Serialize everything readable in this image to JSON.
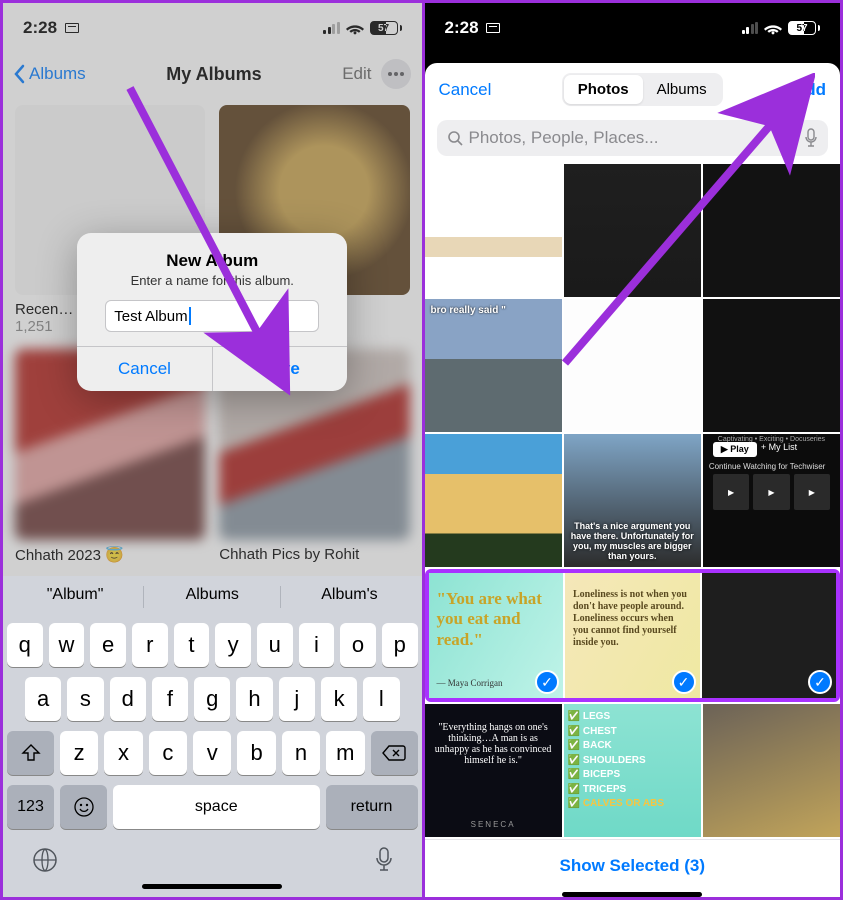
{
  "status": {
    "time": "2:28",
    "battery": "57"
  },
  "left": {
    "back": "Albums",
    "title": "My Albums",
    "edit": "Edit",
    "albums": [
      {
        "name": "Recen…",
        "count": "1,251"
      },
      {
        "name": "",
        "count": ""
      },
      {
        "name": "Chhath 2023 😇",
        "count": ""
      },
      {
        "name": "Chhath Pics by Rohit",
        "count": ""
      }
    ],
    "alert": {
      "title": "New Album",
      "subtitle": "Enter a name for this album.",
      "value": "Test Album",
      "cancel": "Cancel",
      "save": "Save"
    },
    "keyboard": {
      "predict": [
        "\"Album\"",
        "Albums",
        "Album's"
      ],
      "row1": [
        "q",
        "w",
        "e",
        "r",
        "t",
        "y",
        "u",
        "i",
        "o",
        "p"
      ],
      "row2": [
        "a",
        "s",
        "d",
        "f",
        "g",
        "h",
        "j",
        "k",
        "l"
      ],
      "row3": [
        "z",
        "x",
        "c",
        "v",
        "b",
        "n",
        "m"
      ],
      "num": "123",
      "space": "space",
      "ret": "return"
    }
  },
  "right": {
    "cancel": "Cancel",
    "seg_photos": "Photos",
    "seg_albums": "Albums",
    "add": "Add",
    "search_placeholder": "Photos, People, Places...",
    "q1": "\"You are what you eat and read.\"",
    "q1_author": "— Maya Corrigan",
    "q2": "Loneliness is not when you don't have people around. Loneliness occurs when you cannot find yourself inside you.",
    "q3": "\"Everything hangs on one's thinking…A man is as unhappy as he has convinced himself he is.\"",
    "q3_author": "SENECA",
    "t8_caption": "That's a nice argument you have there. Unfortunately for you, my muscles are bigger than yours.",
    "t4_caption": "bro really said \"",
    "t9_cont": "Continue Watching for Techwiser",
    "t9_cats": "Captivating • Exciting • Docuseries",
    "t9_play": "▶ Play",
    "t9_mylist": "+ My List",
    "checklist": [
      "LEGS",
      "CHEST",
      "BACK",
      "SHOULDERS",
      "BICEPS",
      "TRICEPS",
      "CALVES OR ABS"
    ],
    "show_selected": "Show Selected (3)"
  }
}
